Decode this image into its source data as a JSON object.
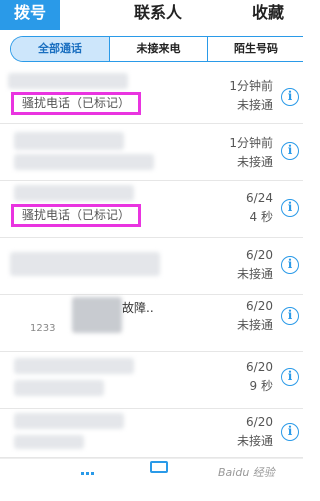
{
  "top_tabs": [
    {
      "label": "拨号",
      "active": true
    },
    {
      "label": "联系人",
      "active": false
    },
    {
      "label": "收藏",
      "active": false
    }
  ],
  "filter_tabs": [
    {
      "label": "全部通话",
      "active": true
    },
    {
      "label": "未接来电",
      "active": false
    },
    {
      "label": "陌生号码",
      "active": false
    }
  ],
  "calls": [
    {
      "tag": "骚扰电话（已标记）",
      "time": "1分钟前",
      "status": "未接通"
    },
    {
      "tag": "",
      "time": "1分钟前",
      "status": "未接通"
    },
    {
      "tag": "骚扰电话（已标记）",
      "time": "6/24",
      "status": "4 秒"
    },
    {
      "tag": "",
      "time": "6/20",
      "status": "未接通"
    },
    {
      "tag": "",
      "time": "6/20",
      "status": "未接通",
      "note": "故障..",
      "number_fragment": "1233"
    },
    {
      "tag": "",
      "time": "6/20",
      "status": "9 秒"
    },
    {
      "tag": "",
      "time": "6/20",
      "status": "未接通"
    }
  ],
  "info_glyph": "i",
  "colors": {
    "accent": "#2a9ae8",
    "highlight": "#e934e0"
  },
  "watermark": "Baidu 经验"
}
